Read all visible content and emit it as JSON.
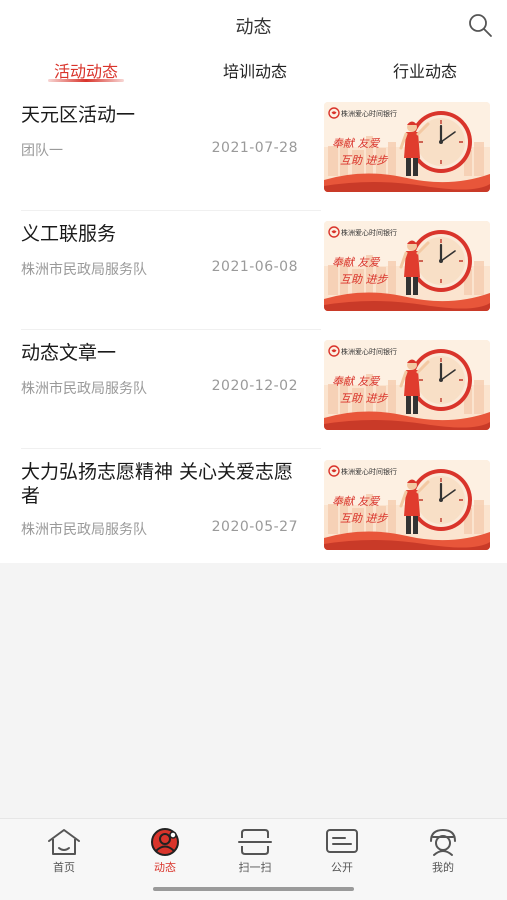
{
  "header": {
    "title": "动态"
  },
  "tabs": [
    {
      "label": "活动动态",
      "active": true
    },
    {
      "label": "培训动态",
      "active": false
    },
    {
      "label": "行业动态",
      "active": false
    }
  ],
  "news": [
    {
      "title": "天元区活动一",
      "source": "团队一",
      "date": "2021-07-28"
    },
    {
      "title": "义工联服务",
      "source": "株洲市民政局服务队",
      "date": "2021-06-08"
    },
    {
      "title": "动态文章一",
      "source": "株洲市民政局服务队",
      "date": "2020-12-02"
    },
    {
      "title": "大力弘扬志愿精神 关心关爱志愿者",
      "source": "株洲市民政局服务队",
      "date": "2020-05-27"
    }
  ],
  "thumbnail": {
    "brand": "株洲爱心时间银行",
    "slogan_line1": "奉献 友爱",
    "slogan_line2": "互助 进步"
  },
  "bottom_nav": [
    {
      "label": "首页",
      "icon": "home-icon",
      "active": false
    },
    {
      "label": "动态",
      "icon": "news-icon",
      "active": true
    },
    {
      "label": "扫一扫",
      "icon": "scan-icon",
      "active": false
    },
    {
      "label": "公开",
      "icon": "announcement-icon",
      "active": false
    },
    {
      "label": "我的",
      "icon": "profile-icon",
      "active": false
    }
  ],
  "colors": {
    "accent": "#d9342b",
    "muted": "#9a9a9a",
    "background": "#f4f4f4"
  }
}
